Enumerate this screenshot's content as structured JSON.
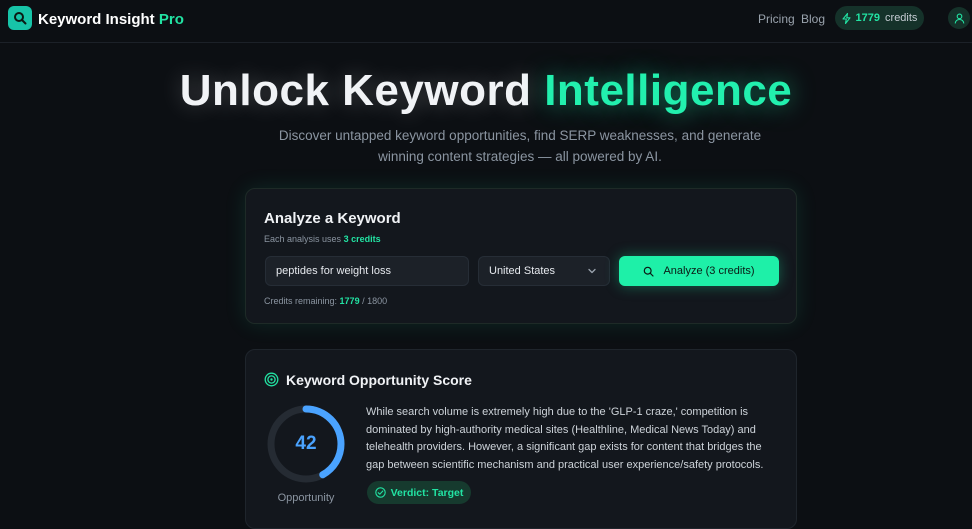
{
  "brand": {
    "name": "Keyword Insight",
    "suffix": "Pro",
    "icon": "search-icon"
  },
  "nav": {
    "links": [
      "Pricing",
      "Blog"
    ],
    "credits_value": "1779",
    "credits_label": "credits",
    "credits_icon": "bolt-icon",
    "avatar_icon": "user-icon"
  },
  "hero": {
    "title_main": "Unlock Keyword",
    "title_accent": "Intelligence",
    "subtitle": "Discover untapped keyword opportunities, find SERP weaknesses, and generate winning content strategies — all powered by AI."
  },
  "analyze": {
    "title": "Analyze a Keyword",
    "note_prefix": "Each analysis uses",
    "note_credits": "3 credits",
    "keyword_value": "peptides for weight loss",
    "country_selected": "United States",
    "button_label": "Analyze (3 credits)",
    "remaining_prefix": "Credits remaining:",
    "remaining_value": "1779",
    "remaining_total": "/ 1800"
  },
  "score": {
    "title": "Keyword Opportunity Score",
    "title_icon": "target-icon",
    "value": 42,
    "max": 100,
    "label": "Opportunity",
    "description": "While search volume is extremely high due to the 'GLP-1 craze,' competition is dominated by high-authority medical sites (Healthline, Medical News Today) and telehealth providers. However, a significant gap exists for content that bridges the gap between scientific mechanism and practical user experience/safety protocols.",
    "verdict": "Verdict: Target",
    "verdict_icon": "check-circle-icon"
  },
  "colors": {
    "accent": "#22e3a3",
    "gauge": "#4aa3ff",
    "background": "#0c0f13",
    "card": "#13171d"
  }
}
